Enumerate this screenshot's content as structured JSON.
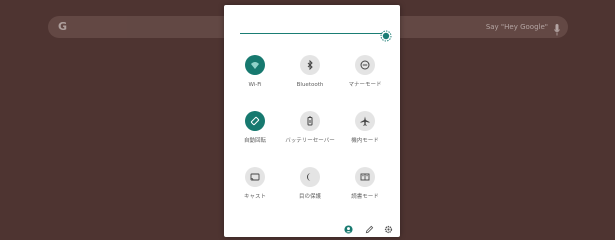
{
  "search": {
    "logo_letter": "G",
    "hint": "Say \"Hey Google\""
  },
  "colors": {
    "accent": "#17796f",
    "wallpaper": "#4e3431",
    "tile_off": "#e4e4e4"
  },
  "quick_settings": {
    "brightness_level": 1.0,
    "tiles": [
      {
        "label": "Wi-Fi",
        "icon": "wifi-icon",
        "active": true
      },
      {
        "label": "Bluetooth",
        "icon": "bluetooth-icon",
        "active": false
      },
      {
        "label": "マナーモード",
        "icon": "do-not-disturb-icon",
        "active": false
      },
      {
        "label": "自動回転",
        "icon": "auto-rotate-icon",
        "active": true
      },
      {
        "label": "バッテリーセーバー",
        "icon": "battery-saver-icon",
        "active": false
      },
      {
        "label": "機内モード",
        "icon": "airplane-mode-icon",
        "active": false
      },
      {
        "label": "キャスト",
        "icon": "cast-icon",
        "active": false
      },
      {
        "label": "目の保護",
        "icon": "night-light-icon",
        "active": false
      },
      {
        "label": "読書モード",
        "icon": "reading-mode-icon",
        "active": false
      }
    ],
    "bottom_icons": [
      "user-icon",
      "edit-icon",
      "settings-icon"
    ]
  }
}
